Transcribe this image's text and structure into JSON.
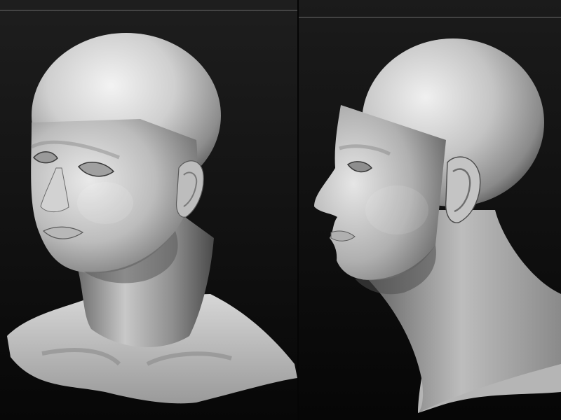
{
  "scene": {
    "views": [
      {
        "label": ""
      },
      {
        "label": ""
      }
    ]
  },
  "colors": {
    "background_top": "#1c1c1c",
    "background_bottom": "#050505",
    "clay_highlight": "#f2f2f2",
    "clay_mid": "#a9a9a9",
    "clay_shadow": "#3a3a3a",
    "rule": "#6a6a6a"
  }
}
